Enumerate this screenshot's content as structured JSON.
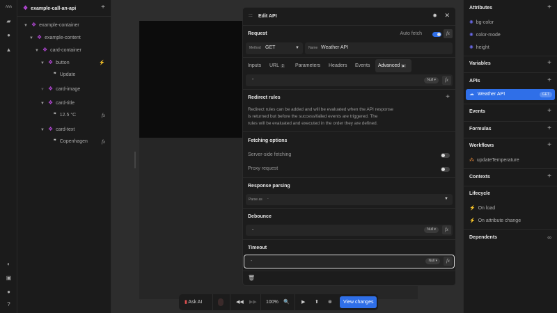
{
  "project": {
    "name": "example-call-an-api"
  },
  "tree": [
    {
      "label": "example-container",
      "kind": "element"
    },
    {
      "label": "example-content",
      "kind": "element"
    },
    {
      "label": "card-container",
      "kind": "element"
    },
    {
      "label": "button",
      "kind": "element"
    },
    {
      "label": "Update",
      "kind": "text"
    },
    {
      "label": "card-image",
      "kind": "element"
    },
    {
      "label": "card-title",
      "kind": "element"
    },
    {
      "label": "12.5 °C",
      "kind": "text"
    },
    {
      "label": "card-text",
      "kind": "element"
    },
    {
      "label": "Copenhagen",
      "kind": "text"
    }
  ],
  "modal": {
    "title": "Edit API",
    "request_label": "Request",
    "auto_fetch_label": "Auto fetch",
    "auto_fetch": true,
    "method_label": "Method",
    "method": "GET",
    "name_label": "Name",
    "name": "Weather API",
    "tabs": [
      {
        "label": "Inputs"
      },
      {
        "label": "URL",
        "badge": "2"
      },
      {
        "label": "Parameters"
      },
      {
        "label": "Headers"
      },
      {
        "label": "Events"
      },
      {
        "label": "Advanced",
        "active": true
      }
    ],
    "advanced_value": "-",
    "null_label": "Null",
    "redirect_title": "Redirect rules",
    "redirect_desc": [
      "Redirect rules can be added and will be evaluated when the API response",
      "is returned but before the success/failed events are triggered. The",
      "rules will be evaluated and executed in the order they are defined."
    ],
    "fetching_title": "Fetching options",
    "server_side": "Server-side fetching",
    "server_side_on": false,
    "proxy": "Proxy request",
    "proxy_on": false,
    "parsing_title": "Response parsing",
    "parse_as": "Parse as",
    "parse_value": "-",
    "debounce_title": "Debounce",
    "debounce_value": "-",
    "timeout_title": "Timeout",
    "timeout_value": "-",
    "fx": "fx"
  },
  "right": {
    "attributes": "Attributes",
    "attr_items": [
      "bg-color",
      "color-mode",
      "height"
    ],
    "variables": "Variables",
    "apis": "APIs",
    "api_item": "Weather API",
    "api_method": "GET",
    "events": "Events",
    "formulas": "Formulas",
    "workflows": "Workflows",
    "workflow_item": "updateTemperature",
    "contexts": "Contexts",
    "lifecycle": "Lifecycle",
    "lifecycle_items": [
      "On load",
      "On attribute change"
    ],
    "dependents": "Dependents"
  },
  "bottombar": {
    "ask_ai": "Ask AI",
    "zoom": "100%",
    "view_changes": "View changes"
  },
  "colors": {
    "accent": "#2f6fe8",
    "element": "#b548d8"
  }
}
